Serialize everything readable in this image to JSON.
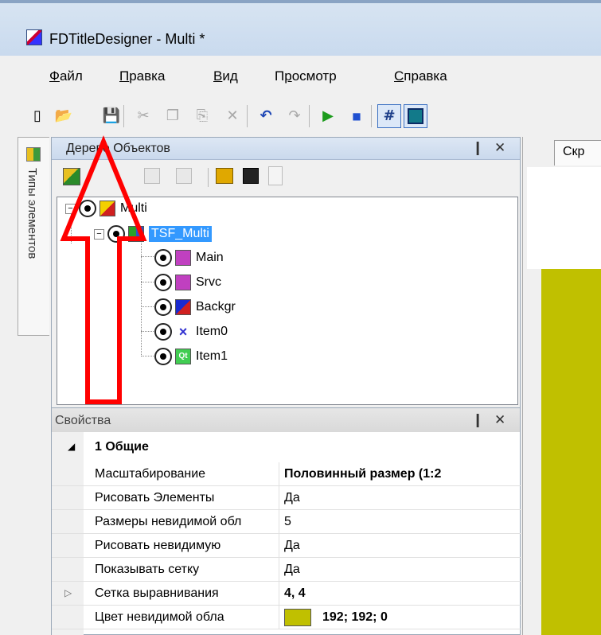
{
  "window": {
    "title": "FDTitleDesigner - Multi *"
  },
  "menubar": {
    "items": [
      {
        "label": "Файл",
        "accel": "Ф",
        "rest": "айл"
      },
      {
        "label": "Правка",
        "accel": "П",
        "rest": "равка"
      },
      {
        "label": "Вид",
        "accel": "В",
        "rest": "ид"
      },
      {
        "label": "Просмотр",
        "pre": "П",
        "accel": "р",
        "rest": "осмотр"
      },
      {
        "label": "Справка",
        "accel": "С",
        "rest": "правка"
      }
    ]
  },
  "toolbar": {
    "icons": [
      "new-icon",
      "open-icon",
      "save-icon",
      "cut-icon",
      "copy-icon",
      "paste-icon",
      "delete-icon",
      "undo-icon",
      "redo-icon",
      "play-icon",
      "stop-icon",
      "grid-icon",
      "frame-icon"
    ],
    "new_glyph": "▯",
    "open_glyph": "📂",
    "save_glyph": "💾",
    "cut_glyph": "✂",
    "copy_glyph": "❐",
    "paste_glyph": "⎘",
    "delete_glyph": "✕",
    "undo_glyph": "↶",
    "redo_glyph": "↷",
    "play_glyph": "▶",
    "stop_glyph": "■",
    "grid_glyph": "#"
  },
  "side_tab": {
    "label": "Типы элементов"
  },
  "tree_panel": {
    "title": "Дерево Объектов",
    "pin_glyph": "❙",
    "close_glyph": "✕",
    "nodes": [
      {
        "label": "Multi",
        "depth": 0,
        "expander": "−",
        "icon": "project-icon",
        "selected": false
      },
      {
        "label": "TSF_Multi",
        "depth": 1,
        "expander": "−",
        "icon": "layout-icon",
        "selected": true
      },
      {
        "label": "Main",
        "depth": 2,
        "icon": "arrow-box-icon",
        "selected": false
      },
      {
        "label": "Srvc",
        "depth": 2,
        "icon": "arrow-box-icon",
        "selected": false
      },
      {
        "label": "Backgr",
        "depth": 2,
        "icon": "film-icon",
        "selected": false
      },
      {
        "label": "Item0",
        "depth": 2,
        "icon": "cross-icon",
        "selected": false
      },
      {
        "label": "Item1",
        "depth": 2,
        "icon": "qt-icon",
        "selected": false
      }
    ]
  },
  "props_panel": {
    "title": "Свойства",
    "category_expander": "◢",
    "category": "1 Общие",
    "rows": [
      {
        "name": "Масштабирование",
        "value": "Половинный размер (1:2",
        "bold": true,
        "expander": ""
      },
      {
        "name": "Рисовать Элементы",
        "value": "Да",
        "bold": false,
        "expander": ""
      },
      {
        "name": "Размеры невидимой обл",
        "value": "5",
        "bold": false,
        "expander": ""
      },
      {
        "name": "Рисовать невидимую",
        "value": "Да",
        "bold": false,
        "expander": ""
      },
      {
        "name": "Показывать сетку",
        "value": "Да",
        "bold": false,
        "expander": ""
      },
      {
        "name": "Сетка выравнивания",
        "value": "4, 4",
        "bold": true,
        "expander": "▷"
      },
      {
        "name": "Цвет невидимой обла",
        "value": "192; 192; 0",
        "bold": true,
        "swatch": "#c0c000",
        "expander": ""
      }
    ]
  },
  "document_tab": {
    "label": "Скр"
  },
  "colors": {
    "canvas": "#c0c000",
    "selection": "#3399ff",
    "annotation_arrow": "#ff0000"
  }
}
